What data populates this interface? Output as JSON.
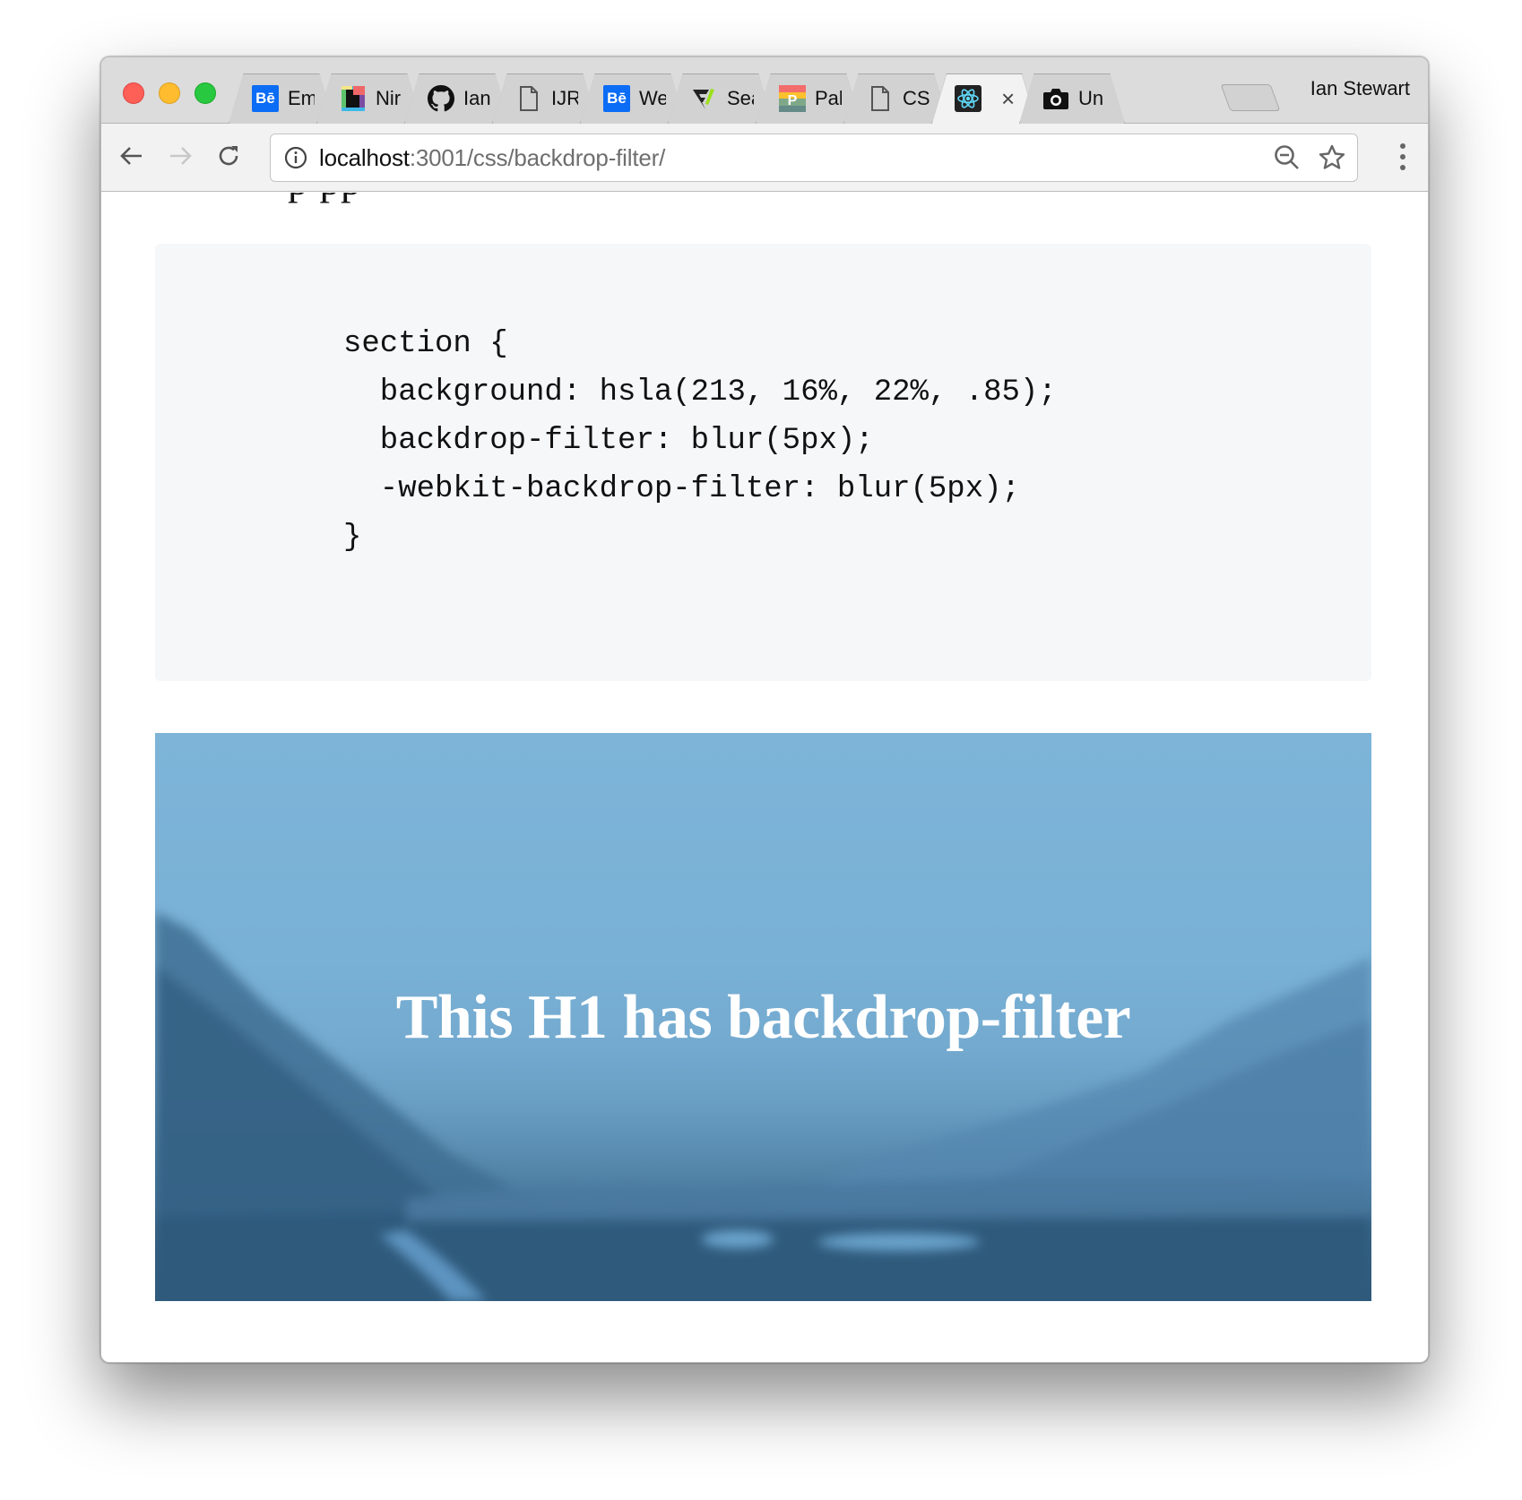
{
  "browser": {
    "tabs": [
      {
        "title": "Em",
        "favicon": "behance-icon",
        "active": false
      },
      {
        "title": "Nir",
        "favicon": "nirvana-app-icon",
        "active": false
      },
      {
        "title": "Ian",
        "favicon": "github-icon",
        "active": false
      },
      {
        "title": "IJR",
        "favicon": "document-icon",
        "active": false
      },
      {
        "title": "We",
        "favicon": "behance-icon",
        "active": false
      },
      {
        "title": "Sea",
        "favicon": "feedly-icon",
        "active": false
      },
      {
        "title": "Pal",
        "favicon": "palette-icon",
        "active": false
      },
      {
        "title": "CS",
        "favicon": "document-icon",
        "active": false
      },
      {
        "title": "",
        "favicon": "react-icon",
        "active": true,
        "close_glyph": "×"
      },
      {
        "title": "Un",
        "favicon": "camera-icon",
        "active": false
      }
    ],
    "profile_name": "Ian Stewart",
    "url_host": "localhost",
    "url_rest": ":3001/css/backdrop-filter/"
  },
  "page": {
    "cut_text": "p               pp",
    "code_lines": [
      "section {",
      "  background: hsla(213, 16%, 22%, .85);",
      "  backdrop-filter: blur(5px);",
      "  -webkit-backdrop-filter: blur(5px);",
      "}"
    ],
    "hero_heading": "This H1 has backdrop-filter"
  },
  "colors": {
    "code_bg": "#f6f7f9",
    "hero_sky": "#7db4d8",
    "hero_ground": "#2f5b7c",
    "traffic_close": "#fe5f57",
    "traffic_min": "#febc2e",
    "traffic_max": "#28c840"
  }
}
